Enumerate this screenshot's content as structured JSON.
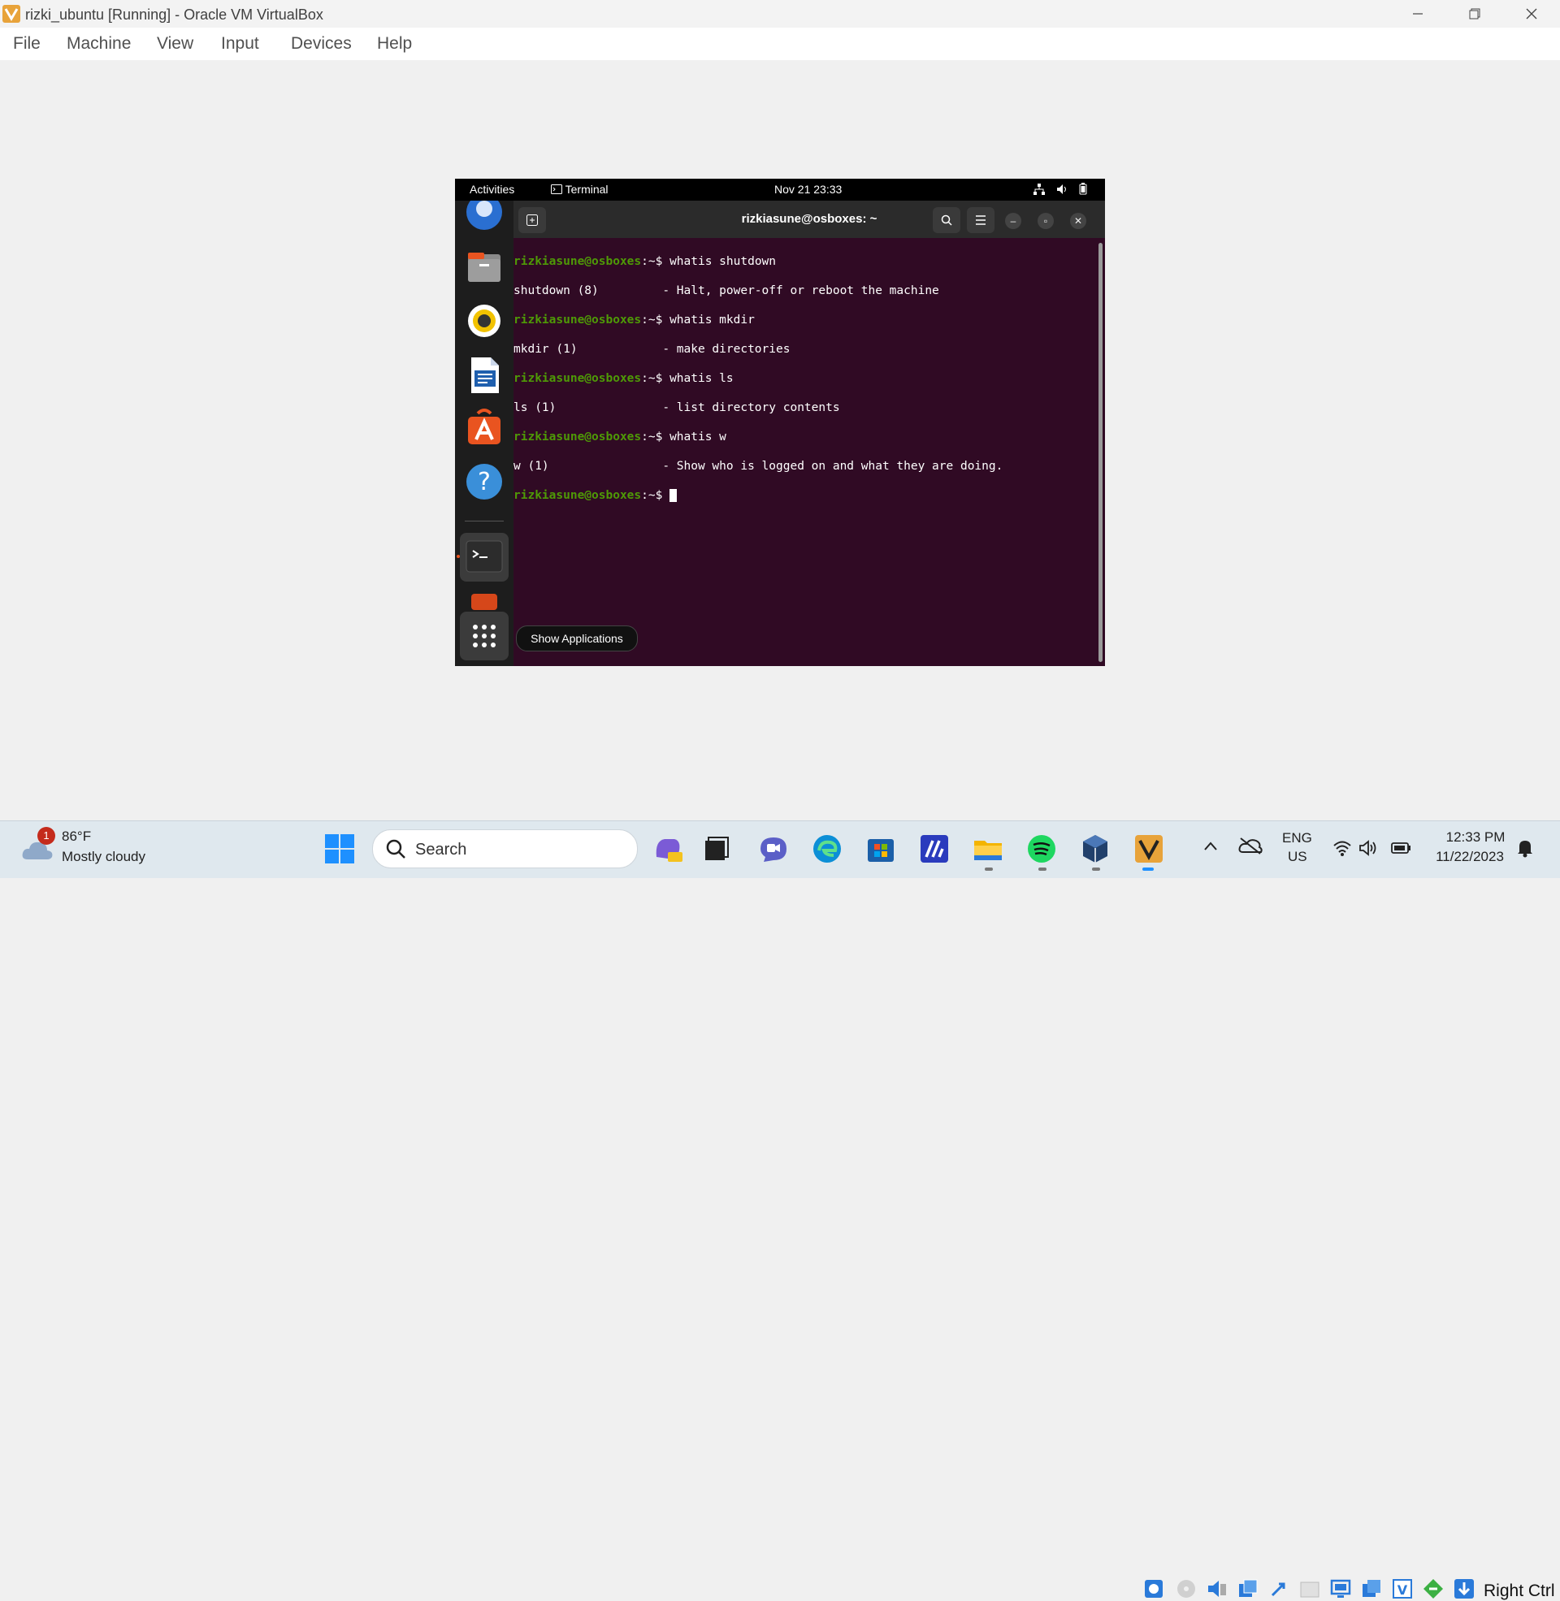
{
  "window": {
    "title": "rizki_ubuntu [Running] - Oracle VM VirtualBox",
    "menu": [
      "File",
      "Machine",
      "View",
      "Input",
      "Devices",
      "Help"
    ]
  },
  "guest": {
    "topbar": {
      "activities": "Activities",
      "app_name": "Terminal",
      "datetime": "Nov 21  23:33"
    },
    "terminal": {
      "title": "rizkiasune@osboxes: ~",
      "prompt": "rizkiasune@osboxes",
      "path": ":~",
      "lines": [
        {
          "type": "cmd",
          "text": "$ whatis shutdown"
        },
        {
          "type": "out",
          "text": "shutdown (8)         - Halt, power-off or reboot the machine"
        },
        {
          "type": "cmd",
          "text": "$ whatis mkdir"
        },
        {
          "type": "out",
          "text": "mkdir (1)            - make directories"
        },
        {
          "type": "cmd",
          "text": "$ whatis ls"
        },
        {
          "type": "out",
          "text": "ls (1)               - list directory contents"
        },
        {
          "type": "cmd",
          "text": "$ whatis w"
        },
        {
          "type": "out",
          "text": "w (1)                - Show who is logged on and what they are doing."
        },
        {
          "type": "cmd",
          "text": "$ "
        }
      ]
    },
    "tooltip": "Show Applications"
  },
  "statusbar": {
    "host_key": "Right Ctrl"
  },
  "taskbar": {
    "weather_temp": "86°F",
    "weather_desc": "Mostly cloudy",
    "weather_badge": "1",
    "search_placeholder": "Search",
    "lang": "ENG",
    "region": "US",
    "time": "12:33 PM",
    "date": "11/22/2023"
  }
}
